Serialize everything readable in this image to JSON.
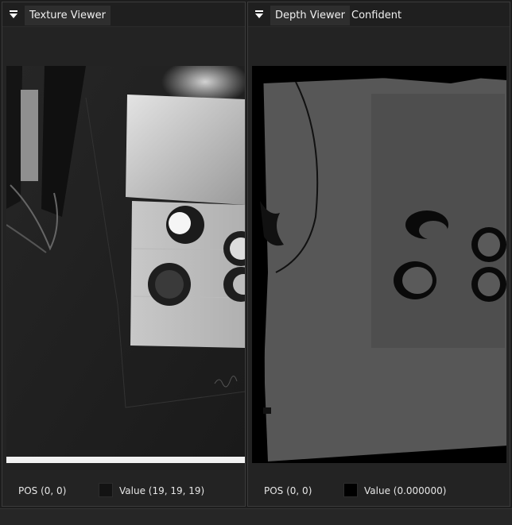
{
  "panels": {
    "texture": {
      "tabs": [
        {
          "label": "Texture Viewer"
        }
      ],
      "status": {
        "pos": "POS (0, 0)",
        "value": "Value (19, 19, 19)",
        "swatch_color": "#131313"
      }
    },
    "depth": {
      "tabs": [
        {
          "label": "Depth Viewer"
        },
        {
          "label": "Confident"
        }
      ],
      "status": {
        "pos": "POS (0, 0)",
        "value": "Value (0.000000)",
        "swatch_color": "#000000"
      }
    }
  },
  "icons": {
    "collapse": "triangle-down-icon"
  },
  "colors": {
    "background": "#1d1d1d",
    "panel": "#232323",
    "text": "#e6e6e6"
  }
}
